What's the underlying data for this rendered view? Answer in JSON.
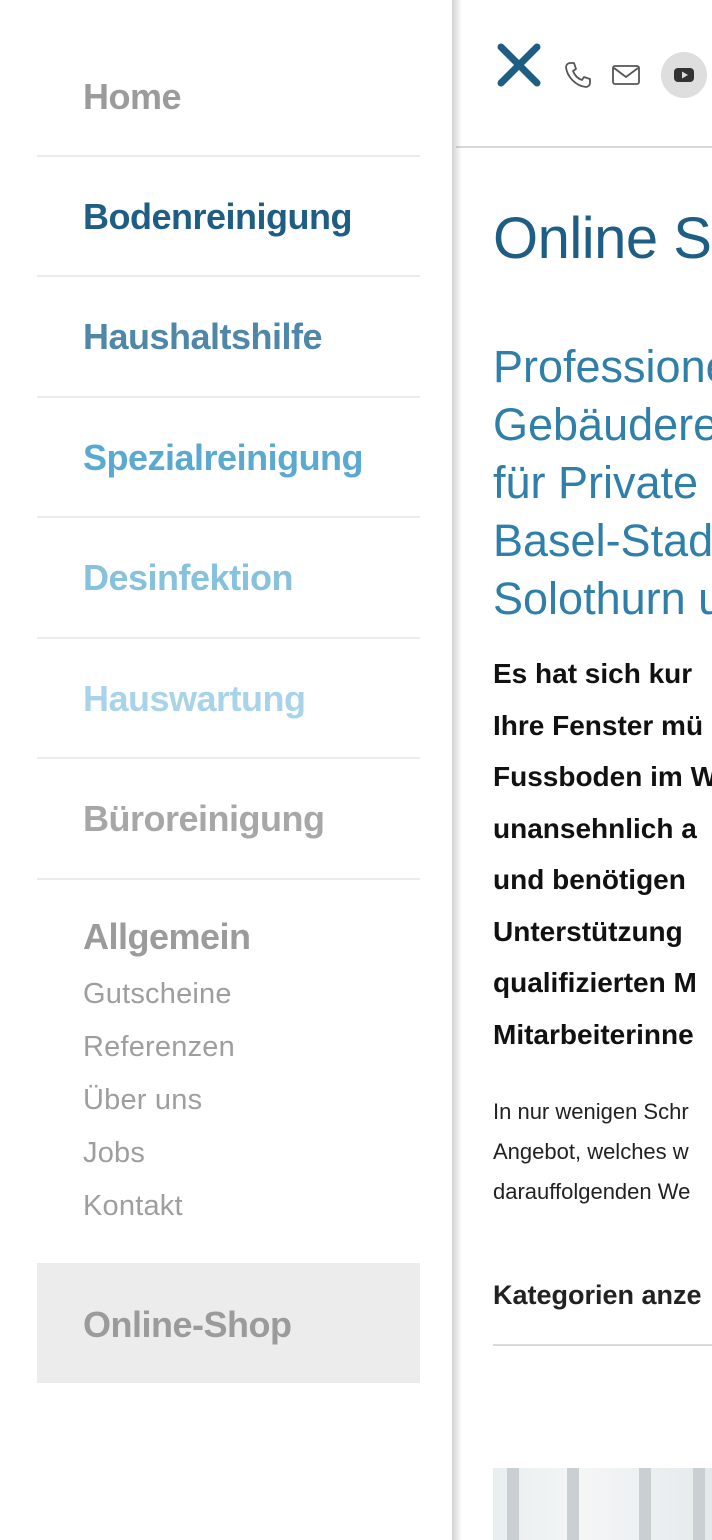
{
  "sidebar": {
    "items": [
      {
        "label": "Home",
        "color": "#9b9b9b"
      },
      {
        "label": "Bodenreinigung",
        "color": "#1e5e84"
      },
      {
        "label": "Haushaltshilfe",
        "color": "#4f87a8"
      },
      {
        "label": "Spezialreinigung",
        "color": "#5aa9d0"
      },
      {
        "label": "Desinfektion",
        "color": "#86c1de"
      },
      {
        "label": "Hauswartung",
        "color": "#a9d3e9"
      },
      {
        "label": "Büroreinigung",
        "color": "#a7a7a7"
      }
    ],
    "general": {
      "title": "Allgemein",
      "links": [
        "Gutscheine",
        "Referenzen",
        "Über uns",
        "Jobs",
        "Kontakt"
      ]
    },
    "shop_label": "Online-Shop"
  },
  "header": {
    "icons": [
      "close-icon",
      "phone-icon",
      "mail-icon",
      "youtube-icon"
    ]
  },
  "main": {
    "title": "Online Sh",
    "subtitle_lines": [
      "Professione",
      "Gebäuderei",
      "für Private",
      "Basel-Stadt",
      "Solothurn u"
    ],
    "intro_lines": [
      "Es hat sich kur",
      "Ihre Fenster mü",
      "Fussboden im W",
      "unansehnlich a",
      "und benötigen",
      "Unterstützung",
      "qualifizierten M",
      "Mitarbeiterinne"
    ],
    "body_lines": [
      "In nur wenigen Schr",
      "Angebot, welches w",
      "darauffolgenden We"
    ],
    "categories_label": "Kategorien anze"
  },
  "colors": {
    "brand_dark": "#1e5e84",
    "brand_mid": "#2f7fa8",
    "shop_bg": "#ececec"
  }
}
